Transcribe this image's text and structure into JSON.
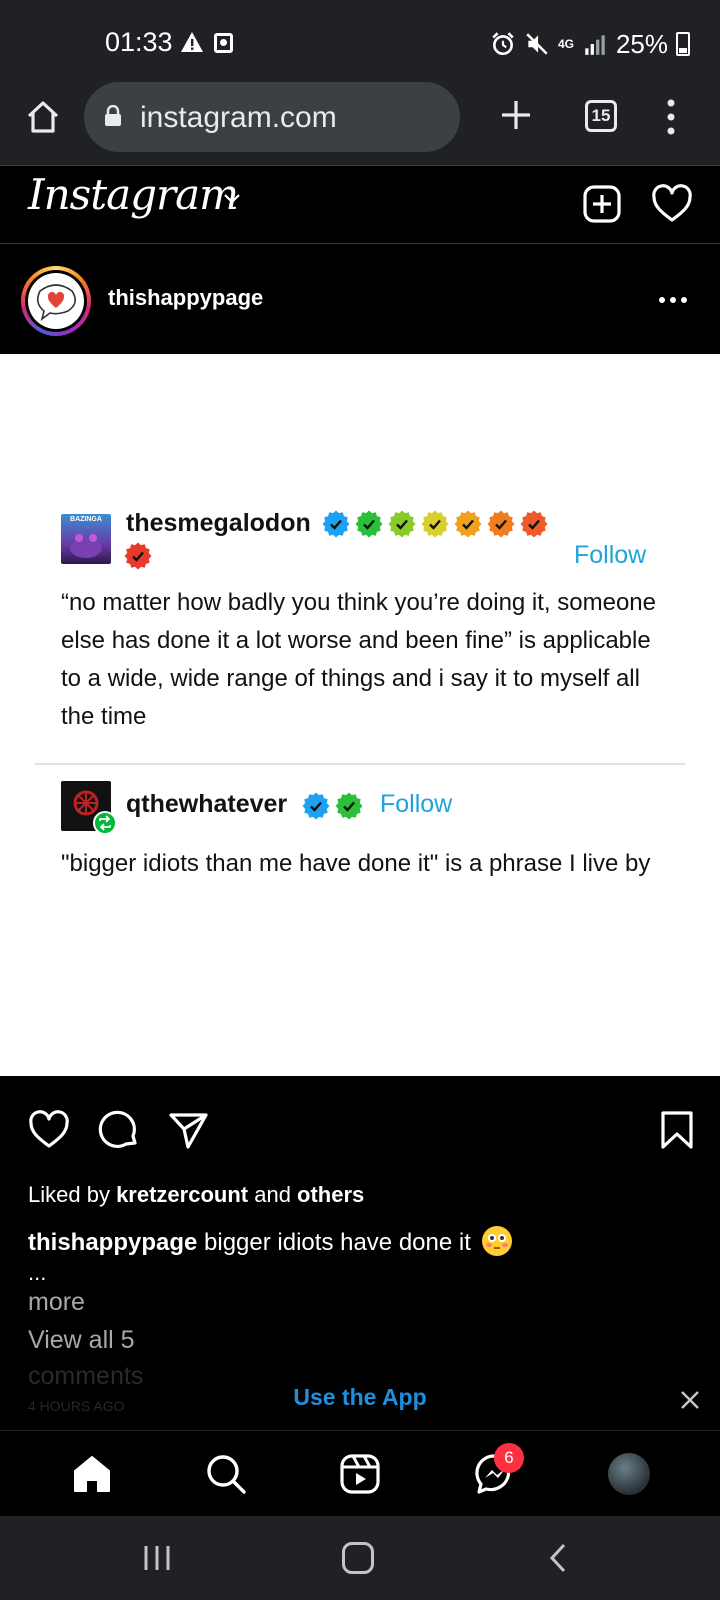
{
  "status_bar": {
    "time": "01:33",
    "network": "4G",
    "battery": "25%",
    "icons": [
      "warning-icon",
      "screen-record-icon",
      "alarm-icon",
      "mute-icon",
      "signal-icon",
      "battery-icon"
    ]
  },
  "browser": {
    "url": "instagram.com",
    "tab_count": "15",
    "icons": [
      "home-icon",
      "lock-icon",
      "plus-icon",
      "tabs-icon",
      "overflow-menu-icon"
    ]
  },
  "instagram": {
    "logo": "Instagram",
    "header_icons": [
      "chevron-down-icon",
      "new-post-icon",
      "heart-icon"
    ]
  },
  "post": {
    "username": "thishappypage",
    "image": {
      "avatar1_label": "BAZINGA",
      "user1": "thesmegalodon",
      "user1_badge_colors": [
        "#1da1f2",
        "#2bbf3a",
        "#8acb2a",
        "#d8cf2a",
        "#f0a21f",
        "#f07d1f",
        "#f05a28",
        "#e83a2a"
      ],
      "follow1": "Follow",
      "text1": "“no matter how badly you think you’re doing it, someone else has done it a lot worse and been fine” is applicable to a wide, wide range of things and i say it to myself all the time",
      "user2": "qthewhatever",
      "user2_badge_colors": [
        "#1da1f2",
        "#2bbf3a"
      ],
      "follow2": "Follow",
      "text2": "\"bigger idiots than me have done it\" is a phrase I live by"
    },
    "liked_by_prefix": "Liked by ",
    "liked_by_user": "kretzercount",
    "liked_by_and": " and ",
    "liked_by_others": "others",
    "caption_user": "thishappypage",
    "caption_text": " bigger idiots have done it ",
    "caption_emoji": "flushed-face-emoji",
    "ellipsis": "...",
    "more": "more",
    "view_all": "View all 5",
    "comments_word": "comments",
    "timestamp": "4 HOURS AGO"
  },
  "banner": {
    "use_app": "Use the App"
  },
  "bottom_nav": {
    "items": [
      "home-icon",
      "search-icon",
      "reels-icon",
      "messenger-icon",
      "profile-avatar"
    ],
    "messages_badge": "6"
  },
  "colors": {
    "accent_blue": "#1fa3d8",
    "use_app_blue": "#1f8fe0",
    "notification_red": "#ff3040"
  }
}
